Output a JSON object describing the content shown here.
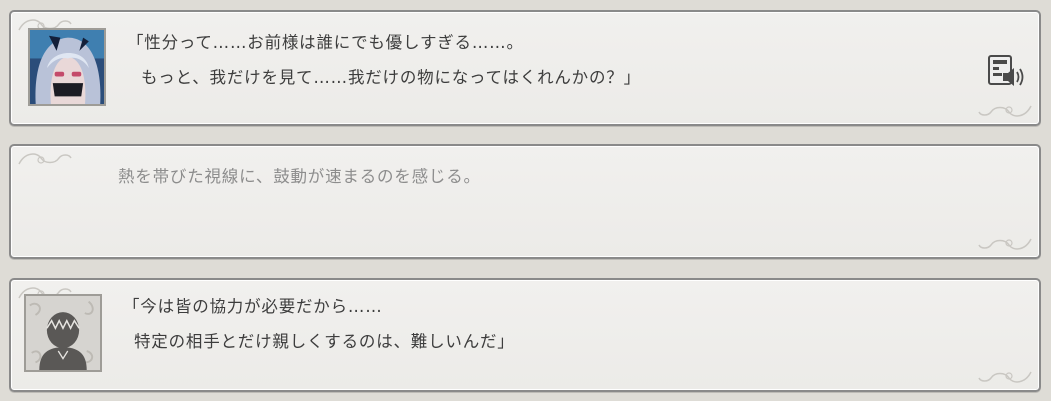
{
  "entries": [
    {
      "speaker_icon": "character-portrait-icon",
      "lines": [
        "「性分って……お前様は誰にでも優しすぎる……。",
        "もっと、我だけを見て……我だけの物になってはくれんかの？」"
      ],
      "has_voice": true,
      "voice_icon": "voice-replay-icon"
    },
    {
      "lines": [
        "熱を帯びた視線に、鼓動が速まるのを感じる。"
      ],
      "has_voice": false
    },
    {
      "speaker_icon": "protagonist-silhouette-icon",
      "lines": [
        "「今は皆の協力が必要だから……",
        "特定の相手とだけ親しくするのは、難しいんだ」"
      ],
      "has_voice": false
    }
  ],
  "colors": {
    "background": "#dedcd6",
    "panel": "#f1f0ee",
    "border": "#8a8a8a",
    "dialogue_text": "#3d3d3d",
    "narration_text": "#8d8d8d"
  }
}
